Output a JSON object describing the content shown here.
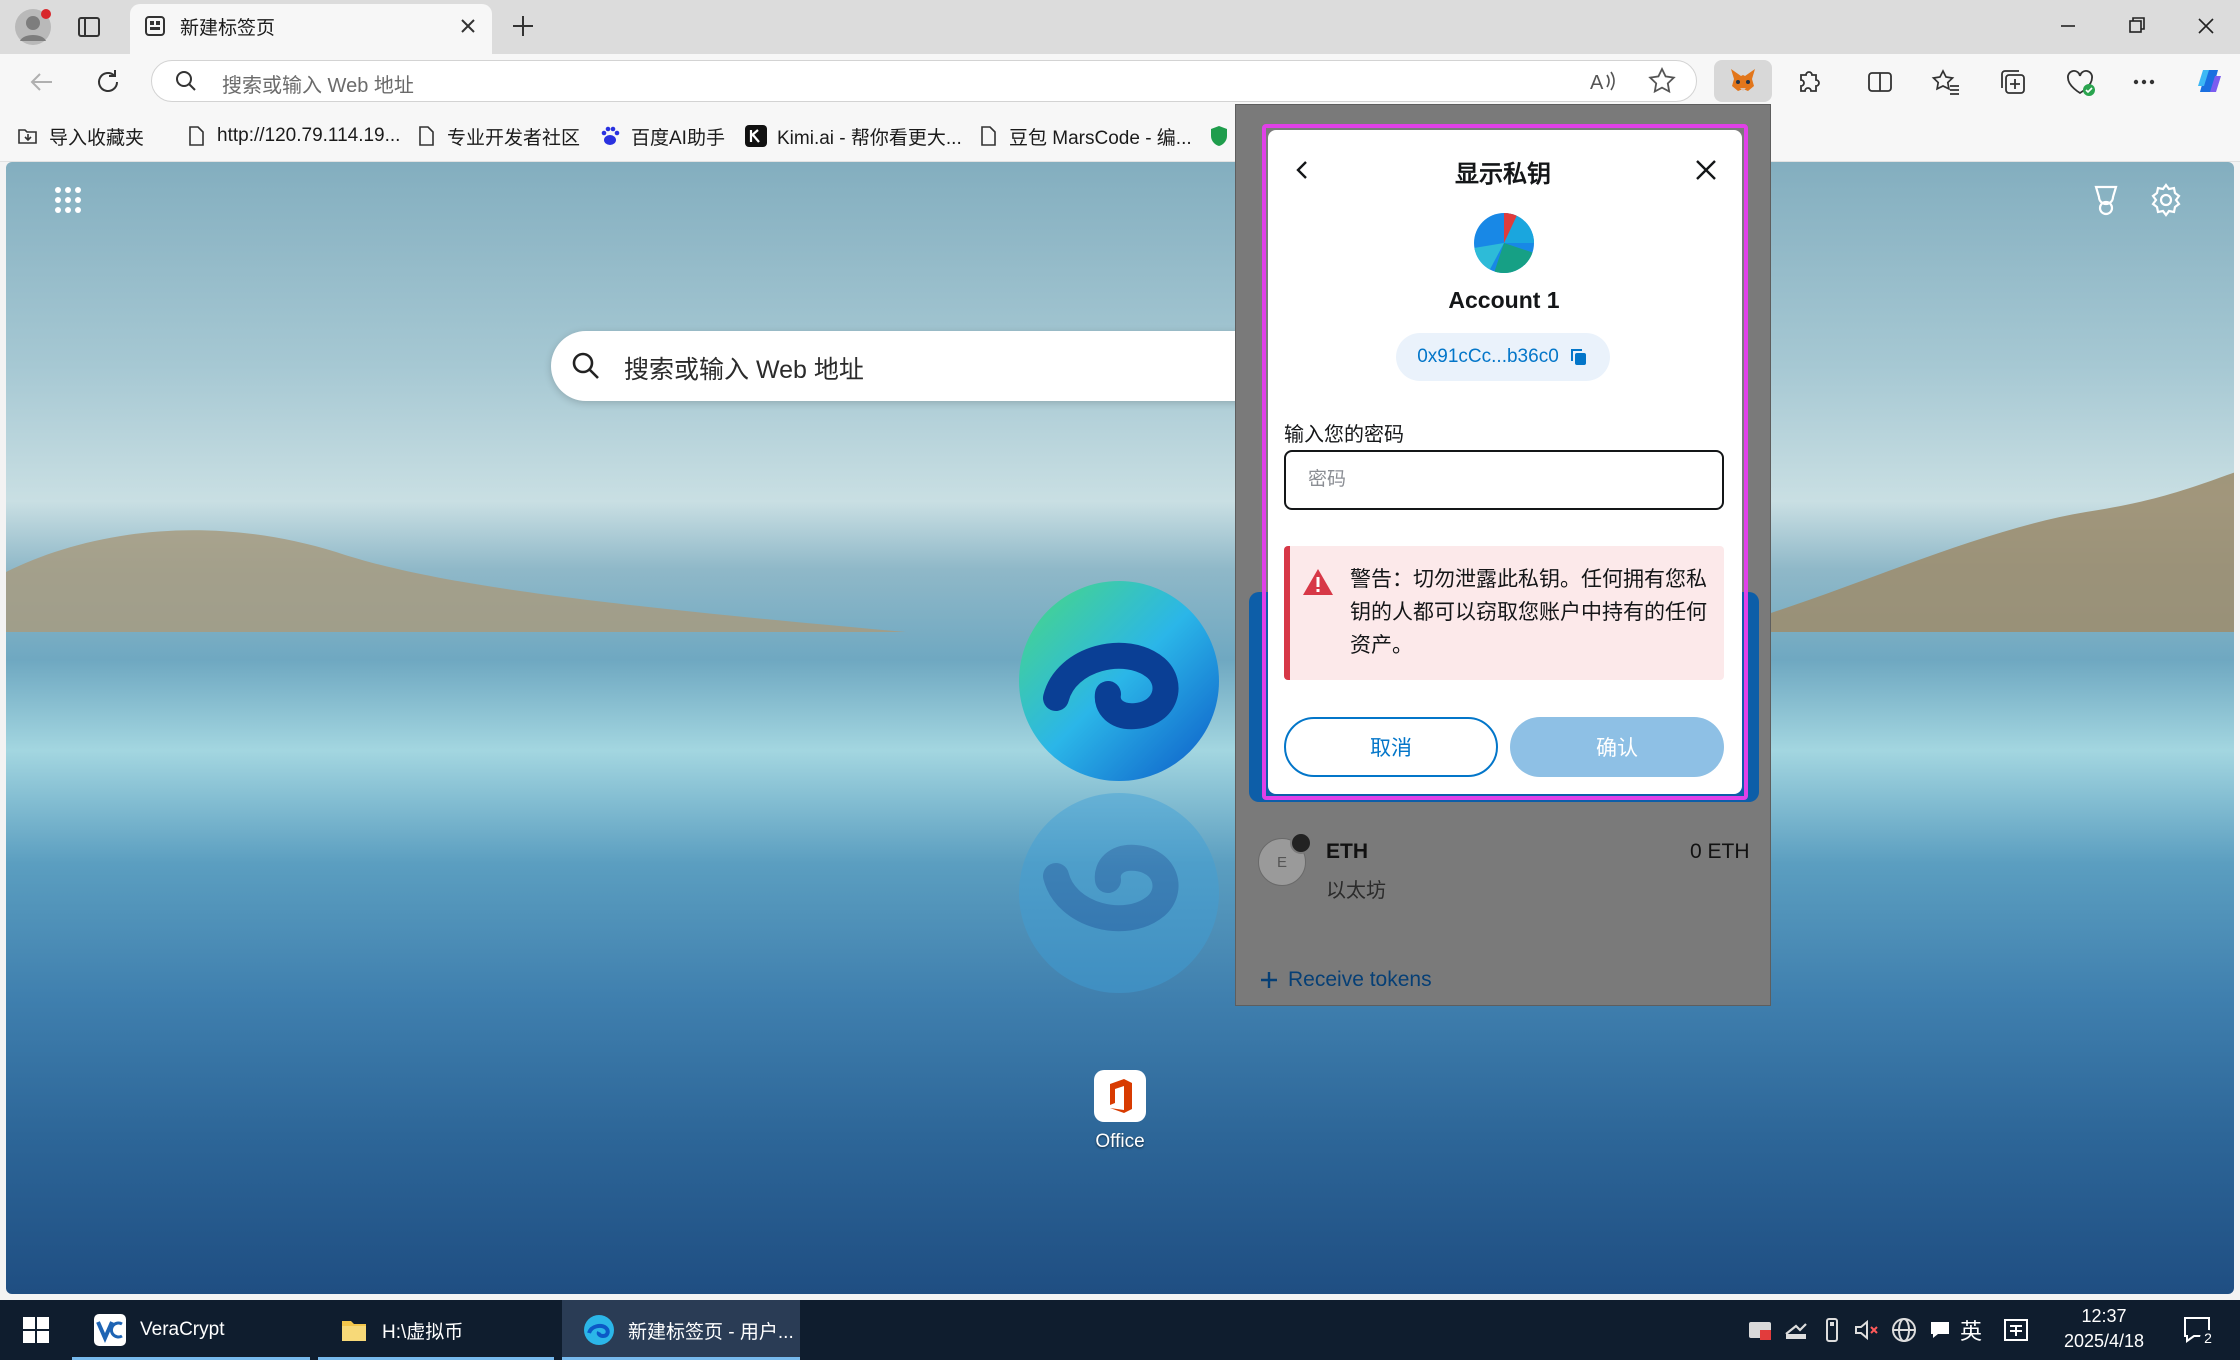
{
  "browser": {
    "tab_title": "新建标签页",
    "address_placeholder": "搜索或输入 Web 地址"
  },
  "bookmarks": [
    {
      "label": "导入收藏夹",
      "icon": "import-folder-icon"
    },
    {
      "label": "http://120.79.114.19...",
      "icon": "page-icon"
    },
    {
      "label": "专业开发者社区",
      "icon": "page-icon"
    },
    {
      "label": "百度AI助手",
      "icon": "baidu-paw-icon"
    },
    {
      "label": "Kimi.ai - 帮你看更大...",
      "icon": "kimi-icon"
    },
    {
      "label": "豆包 MarsCode - 编...",
      "icon": "page-icon"
    }
  ],
  "newtab": {
    "search_placeholder": "搜索或输入 Web 地址",
    "shortcut_label": "Office"
  },
  "metamask": {
    "dialog": {
      "title": "显示私钥",
      "account_name": "Account 1",
      "address": "0x91cCc...b36c0",
      "password_label": "输入您的密码",
      "password_placeholder": "密码",
      "warning": "警告：切勿泄露此私钥。任何拥有您私钥的人都可以窃取您账户中持有的任何资产。",
      "cancel_label": "取消",
      "confirm_label": "确认"
    },
    "token": {
      "icon_letter": "E",
      "name": "ETH",
      "subtitle": "以太坊",
      "balance": "0 ETH"
    },
    "receive_label": "Receive tokens"
  },
  "taskbar": {
    "apps": [
      {
        "label": "VeraCrypt",
        "icon": "veracrypt-icon"
      },
      {
        "label": "H:\\虚拟币",
        "icon": "folder-icon"
      },
      {
        "label": "新建标签页 - 用户...",
        "icon": "edge-icon"
      }
    ],
    "input_language": "英",
    "time": "12:37",
    "date": "2025/4/18",
    "notification_count": "2"
  },
  "colors": {
    "accent_blue": "#0376c9",
    "highlight_frame": "#e040e8",
    "warning_red": "#d73847"
  }
}
